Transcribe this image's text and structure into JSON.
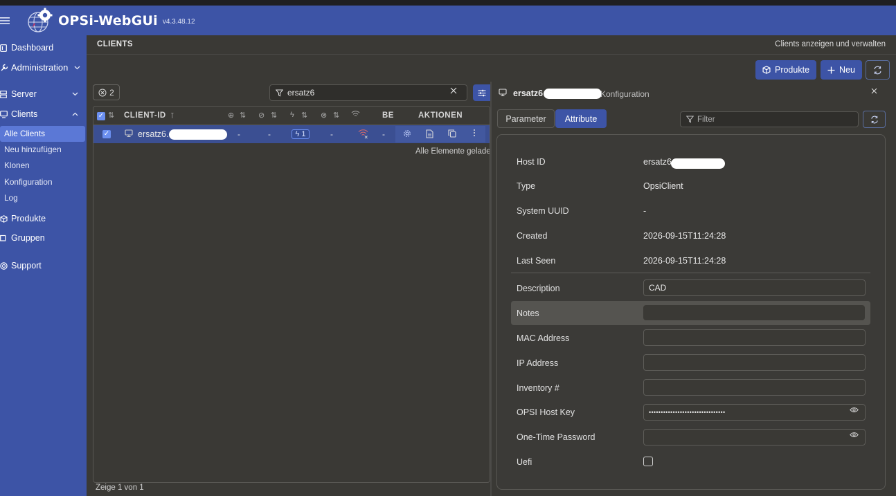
{
  "app": {
    "name": "OPSi-WebGUi",
    "version": "v4.3.48.12"
  },
  "sidebar": {
    "items": [
      {
        "label": "Dashboard"
      },
      {
        "label": "Administration"
      },
      {
        "label": "Server"
      },
      {
        "label": "Clients"
      },
      {
        "label": "Produkte"
      },
      {
        "label": "Gruppen"
      },
      {
        "label": "Support"
      }
    ],
    "clients_sub": [
      {
        "label": "Alle Clients"
      },
      {
        "label": "Neu hinzufügen"
      },
      {
        "label": "Klonen"
      },
      {
        "label": "Konfiguration"
      },
      {
        "label": "Log"
      }
    ]
  },
  "breadcrumb": {
    "title": "CLIENTS",
    "description": "Clients anzeigen und verwalten"
  },
  "toolbar": {
    "products_label": "Produkte",
    "new_label": "Neu"
  },
  "filter_chip": {
    "count": "2"
  },
  "search": {
    "value": "ersatz6"
  },
  "table": {
    "headers": {
      "client_id": "CLIENT-ID",
      "be": "BE",
      "actions": "AKTIONEN"
    },
    "rows": [
      {
        "client_id": "ersatz6.",
        "col1": "-",
        "col2": "-",
        "badge": "1",
        "col4": "-",
        "col6": "-"
      }
    ],
    "status_message": "Alle Elemente geladen",
    "footer": "Zeige 1 von 1"
  },
  "details": {
    "title": "ersatz6",
    "subtitle": "Konfiguration",
    "tabs": [
      "Parameter",
      "Attribute"
    ],
    "active_tab": "Attribute",
    "filter_placeholder": "Filter",
    "attributes": {
      "host_id": {
        "label": "Host ID",
        "value": "ersatz6."
      },
      "type": {
        "label": "Type",
        "value": "OpsiClient"
      },
      "system_uuid": {
        "label": "System UUID",
        "value": "-"
      },
      "created": {
        "label": "Created",
        "value": "2026-09-15T11:24:28"
      },
      "last_seen": {
        "label": "Last Seen",
        "value": "2026-09-15T11:24:28"
      },
      "description": {
        "label": "Description",
        "value": "CAD"
      },
      "notes": {
        "label": "Notes",
        "value": ""
      },
      "mac_address": {
        "label": "MAC Address",
        "value": ""
      },
      "ip_address": {
        "label": "IP Address",
        "value": ""
      },
      "inventory": {
        "label": "Inventory #",
        "value": ""
      },
      "opsi_host_key": {
        "label": "OPSI Host Key",
        "value": "••••••••••••••••••••••••••••••••"
      },
      "one_time_password": {
        "label": "One-Time Password",
        "value": ""
      },
      "uefi": {
        "label": "Uefi",
        "checked": false
      }
    }
  },
  "colors": {
    "primary": "#3d54a6",
    "accent": "#6b8ff0",
    "background": "#3a3935",
    "selected_row": "#3b4f92"
  }
}
